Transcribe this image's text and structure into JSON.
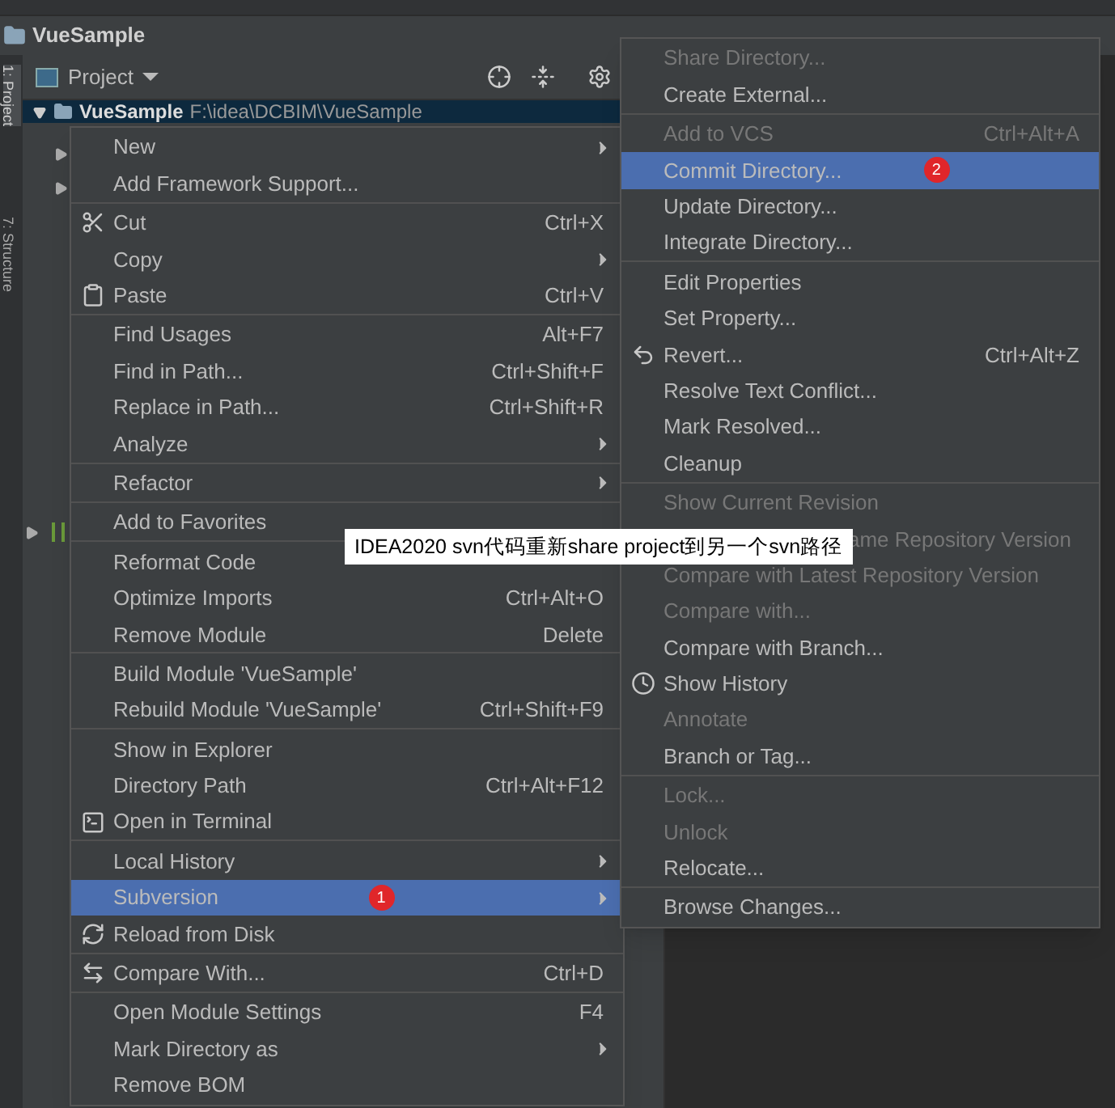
{
  "window": {
    "title": "VueSample"
  },
  "side_tabs": [
    "1: Project",
    "7: Structure"
  ],
  "project_toolbar": {
    "label": "Project"
  },
  "tree": {
    "root": {
      "name": "VueSample",
      "path": "F:\\idea\\DCBIM\\VueSample",
      "selected": true,
      "expanded": true
    }
  },
  "context_menu": {
    "groups": [
      [
        {
          "label": "New",
          "submenu": true
        },
        {
          "label": "Add Framework Support..."
        }
      ],
      [
        {
          "label": "Cut",
          "shortcut": "Ctrl+X",
          "icon": true
        },
        {
          "label": "Copy",
          "submenu": true
        },
        {
          "label": "Paste",
          "shortcut": "Ctrl+V",
          "icon": true
        }
      ],
      [
        {
          "label": "Find Usages",
          "shortcut": "Alt+F7"
        },
        {
          "label": "Find in Path...",
          "shortcut": "Ctrl+Shift+F"
        },
        {
          "label": "Replace in Path...",
          "shortcut": "Ctrl+Shift+R"
        },
        {
          "label": "Analyze",
          "submenu": true
        }
      ],
      [
        {
          "label": "Refactor",
          "submenu": true
        }
      ],
      [
        {
          "label": "Add to Favorites"
        }
      ],
      [
        {
          "label": "Reformat Code"
        },
        {
          "label": "Optimize Imports",
          "shortcut": "Ctrl+Alt+O"
        },
        {
          "label": "Remove Module",
          "shortcut": "Delete"
        }
      ],
      [
        {
          "label": "Build Module 'VueSample'"
        },
        {
          "label": "Rebuild Module 'VueSample'",
          "shortcut": "Ctrl+Shift+F9"
        }
      ],
      [
        {
          "label": "Show in Explorer"
        },
        {
          "label": "Directory Path",
          "shortcut": "Ctrl+Alt+F12"
        },
        {
          "label": "Open in Terminal",
          "icon": true
        }
      ],
      [
        {
          "label": "Local History",
          "submenu": true
        },
        {
          "label": "Subversion",
          "submenu": true,
          "selected": true,
          "badge": "1"
        },
        {
          "label": "Reload from Disk",
          "icon": true
        }
      ],
      [
        {
          "label": "Compare With...",
          "shortcut": "Ctrl+D",
          "icon": true
        }
      ],
      [
        {
          "label": "Open Module Settings",
          "shortcut": "F4"
        },
        {
          "label": "Mark Directory as",
          "submenu": true
        },
        {
          "label": "Remove BOM"
        }
      ]
    ]
  },
  "submenu": {
    "groups": [
      [
        {
          "label": "Share Directory...",
          "disabled": true
        },
        {
          "label": "Create External..."
        }
      ],
      [
        {
          "label": "Add to VCS",
          "shortcut": "Ctrl+Alt+A",
          "disabled": true
        },
        {
          "label": "Commit Directory...",
          "selected": true,
          "badge": "2"
        },
        {
          "label": "Update Directory..."
        },
        {
          "label": "Integrate Directory..."
        }
      ],
      [
        {
          "label": "Edit Properties"
        },
        {
          "label": "Set Property..."
        },
        {
          "label": "Revert...",
          "shortcut": "Ctrl+Alt+Z",
          "icon": true
        },
        {
          "label": "Resolve Text Conflict..."
        },
        {
          "label": "Mark Resolved..."
        },
        {
          "label": "Cleanup"
        }
      ],
      [
        {
          "label": "Show Current Revision",
          "disabled": true
        },
        {
          "label": "ame Repository Version",
          "disabled": true,
          "covered": true
        },
        {
          "label": "Compare with Latest Repository Version",
          "disabled": true
        },
        {
          "label": "Compare with...",
          "disabled": true
        },
        {
          "label": "Compare with Branch..."
        },
        {
          "label": "Show History",
          "icon": true
        },
        {
          "label": "Annotate",
          "disabled": true
        },
        {
          "label": "Branch or Tag..."
        }
      ],
      [
        {
          "label": "Lock...",
          "disabled": true
        },
        {
          "label": "Unlock",
          "disabled": true
        },
        {
          "label": "Relocate..."
        }
      ],
      [
        {
          "label": "Browse Changes..."
        }
      ]
    ]
  },
  "caption": "IDEA2020 svn代码重新share project到另一个svn路径"
}
